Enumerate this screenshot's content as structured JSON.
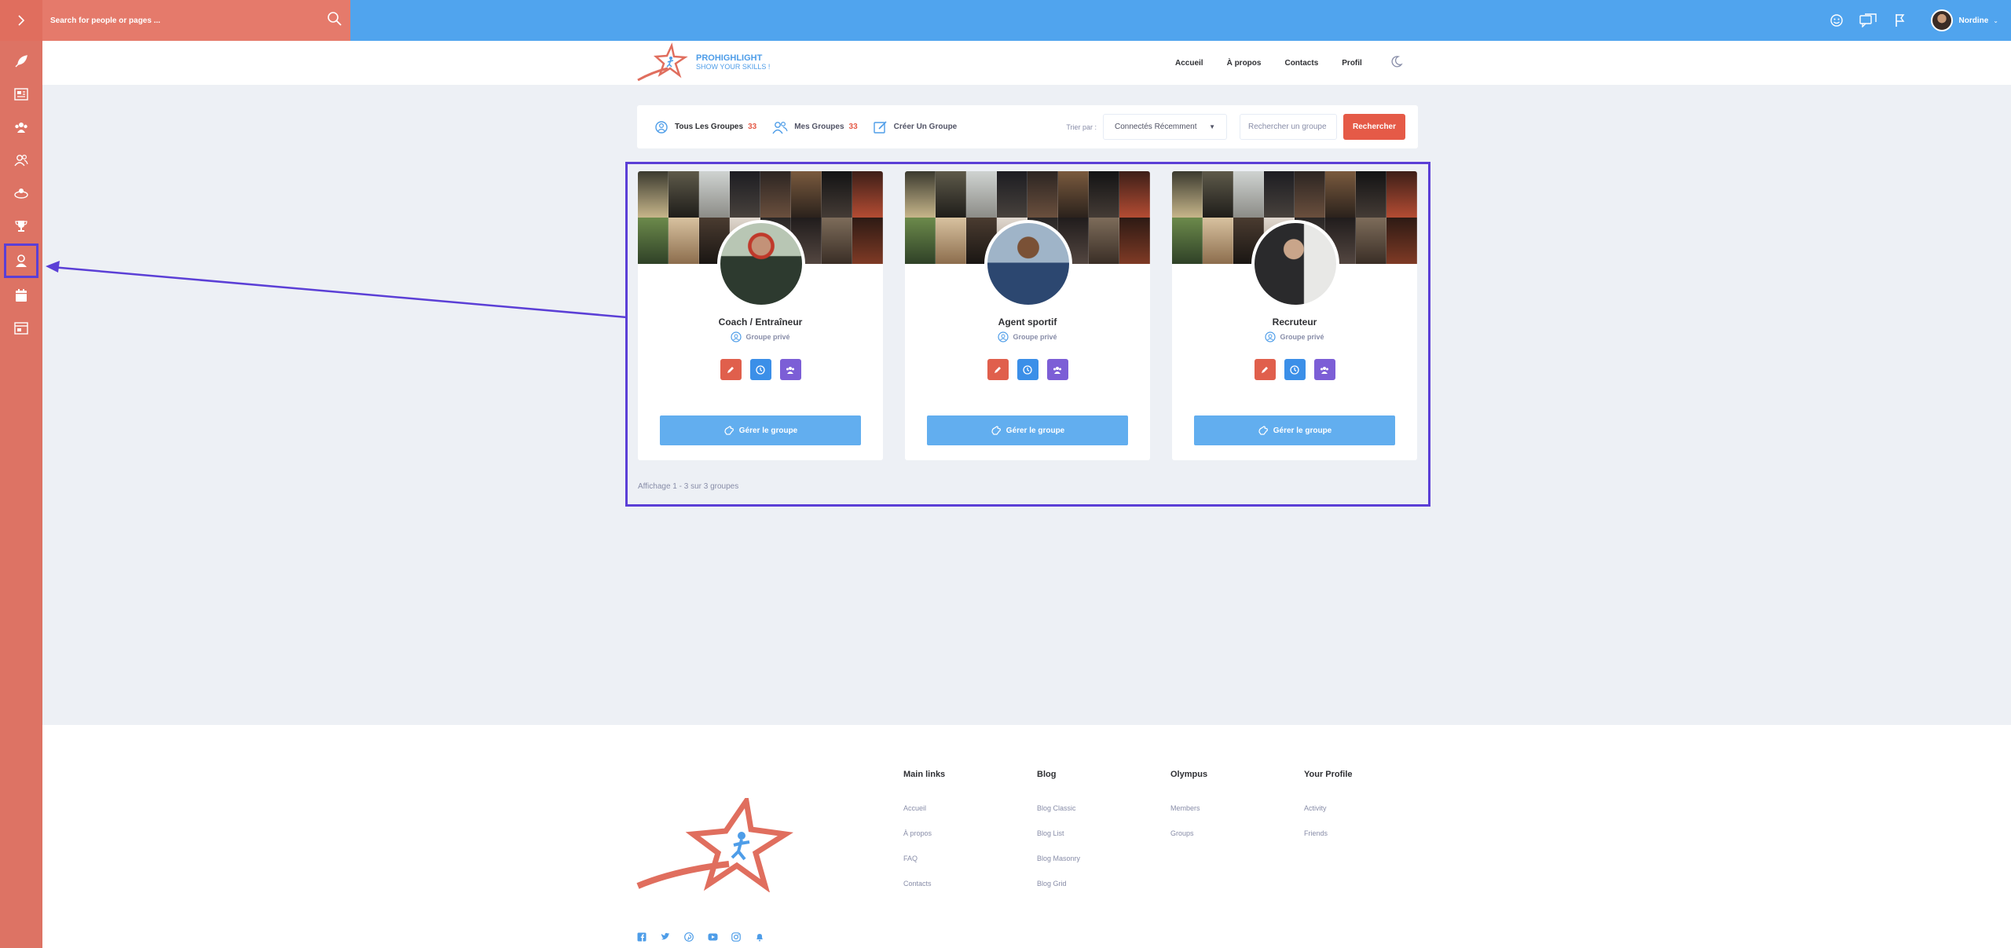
{
  "topbar": {
    "search_placeholder": "Search for people or pages ...",
    "user_name": "Nordine"
  },
  "header": {
    "brand_name": "PROHIGHLIGHT",
    "brand_tagline": "SHOW YOUR SKILLS !",
    "nav": [
      "Accueil",
      "À propos",
      "Contacts",
      "Profil"
    ]
  },
  "filters": {
    "tabs": [
      {
        "label": "Tous Les Groupes",
        "count": "33"
      },
      {
        "label": "Mes Groupes",
        "count": "33"
      },
      {
        "label": "Créer Un Groupe"
      }
    ],
    "sort_label": "Trier par :",
    "sort_value": "Connectés Récemment",
    "search_placeholder": "Rechercher un groupe",
    "search_button": "Rechercher"
  },
  "groups": [
    {
      "title": "Coach / Entraîneur",
      "privacy": "Groupe privé",
      "manage_label": "Gérer le groupe"
    },
    {
      "title": "Agent sportif",
      "privacy": "Groupe privé",
      "manage_label": "Gérer le groupe"
    },
    {
      "title": "Recruteur",
      "privacy": "Groupe privé",
      "manage_label": "Gérer le groupe"
    }
  ],
  "pagination_text": "Affichage 1 - 3 sur 3 groupes",
  "footer": {
    "columns": [
      {
        "title": "Main links",
        "links": [
          "Accueil",
          "À propos",
          "FAQ",
          "Contacts"
        ]
      },
      {
        "title": "Blog",
        "links": [
          "Blog Classic",
          "Blog List",
          "Blog Masonry",
          "Blog Grid"
        ]
      },
      {
        "title": "Olympus",
        "links": [
          "Members",
          "Groups"
        ]
      },
      {
        "title": "Your Profile",
        "links": [
          "Activity",
          "Friends"
        ]
      }
    ],
    "socials": [
      "facebook-icon",
      "twitter-icon",
      "pinterest-icon",
      "youtube-icon",
      "instagram-icon",
      "bell-icon"
    ]
  },
  "colors": {
    "accent_red": "#e55a47",
    "accent_blue": "#50a4ee",
    "sidebar": "#dd7364",
    "highlight": "#5b3fd6"
  }
}
